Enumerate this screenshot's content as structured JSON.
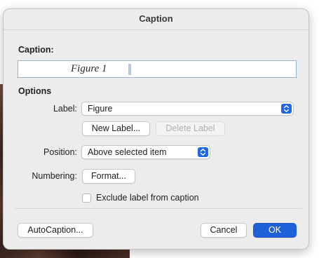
{
  "dialog": {
    "title": "Caption",
    "caption_label": "Caption:",
    "caption_value": "Figure 1",
    "options_label": "Options",
    "label_label": "Label:",
    "label_value": "Figure",
    "new_label_button": "New Label...",
    "delete_label_button": "Delete Label",
    "position_label": "Position:",
    "position_value": "Above selected item",
    "numbering_label": "Numbering:",
    "format_button": "Format...",
    "exclude_label": "Exclude label from caption",
    "exclude_checked": false,
    "autocaption_button": "AutoCaption...",
    "cancel_button": "Cancel",
    "ok_button": "OK"
  },
  "colors": {
    "accent": "#1f5fd8",
    "dialog_bg": "#ececec"
  },
  "icons": {
    "popup_chevron": "chevron-up-down-icon"
  }
}
